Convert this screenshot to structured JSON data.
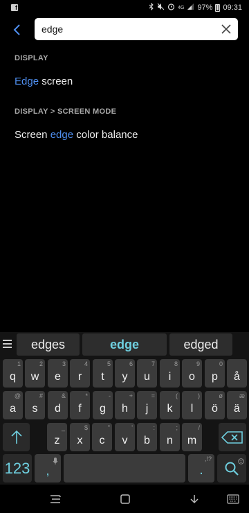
{
  "status_bar": {
    "battery": "97%",
    "time": "09:31",
    "network": "4G"
  },
  "search": {
    "query": "edge"
  },
  "results": [
    {
      "section": "DISPLAY",
      "before": "",
      "match": "Edge",
      "after": " screen"
    },
    {
      "section": "DISPLAY > SCREEN MODE",
      "before": "Screen ",
      "match": "edge",
      "after": " color balance"
    }
  ],
  "suggestions": [
    "edges",
    "edge",
    "edged"
  ],
  "keyboard": {
    "row1": [
      {
        "main": "q",
        "sup": "1"
      },
      {
        "main": "w",
        "sup": "2"
      },
      {
        "main": "e",
        "sup": "3"
      },
      {
        "main": "r",
        "sup": "4"
      },
      {
        "main": "t",
        "sup": "5"
      },
      {
        "main": "y",
        "sup": "6"
      },
      {
        "main": "u",
        "sup": "7"
      },
      {
        "main": "i",
        "sup": "8"
      },
      {
        "main": "o",
        "sup": "9"
      },
      {
        "main": "p",
        "sup": "0"
      },
      {
        "main": "å",
        "sup": ""
      }
    ],
    "row2": [
      {
        "main": "a",
        "sup": "@"
      },
      {
        "main": "s",
        "sup": "#"
      },
      {
        "main": "d",
        "sup": "&"
      },
      {
        "main": "f",
        "sup": "*"
      },
      {
        "main": "g",
        "sup": "-"
      },
      {
        "main": "h",
        "sup": "+"
      },
      {
        "main": "j",
        "sup": "="
      },
      {
        "main": "k",
        "sup": "("
      },
      {
        "main": "l",
        "sup": ")"
      },
      {
        "main": "ö",
        "sup": "ø"
      },
      {
        "main": "ä",
        "sup": "æ"
      }
    ],
    "row3": [
      {
        "main": "z",
        "sup": "_"
      },
      {
        "main": "x",
        "sup": "$"
      },
      {
        "main": "c",
        "sup": "\""
      },
      {
        "main": "v",
        "sup": "'"
      },
      {
        "main": "b",
        "sup": ":"
      },
      {
        "main": "n",
        "sup": ";"
      },
      {
        "main": "m",
        "sup": "/"
      }
    ],
    "num_label": "123",
    "comma_label": ",",
    "period_label": ".",
    "period_sup": ",!?"
  }
}
